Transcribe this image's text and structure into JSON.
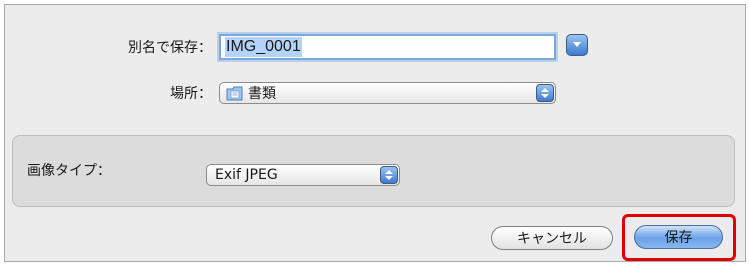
{
  "save_as": {
    "label": "別名で保存：",
    "value": "IMG_0001"
  },
  "location": {
    "label": "場所：",
    "selected": "書類",
    "icon": "documents-folder-icon"
  },
  "image_type": {
    "label": "画像タイプ：",
    "selected": "Exif JPEG"
  },
  "buttons": {
    "cancel": "キャンセル",
    "save": "保存"
  },
  "colors": {
    "accent": "#3d7ad1",
    "highlight": "#e00000"
  }
}
